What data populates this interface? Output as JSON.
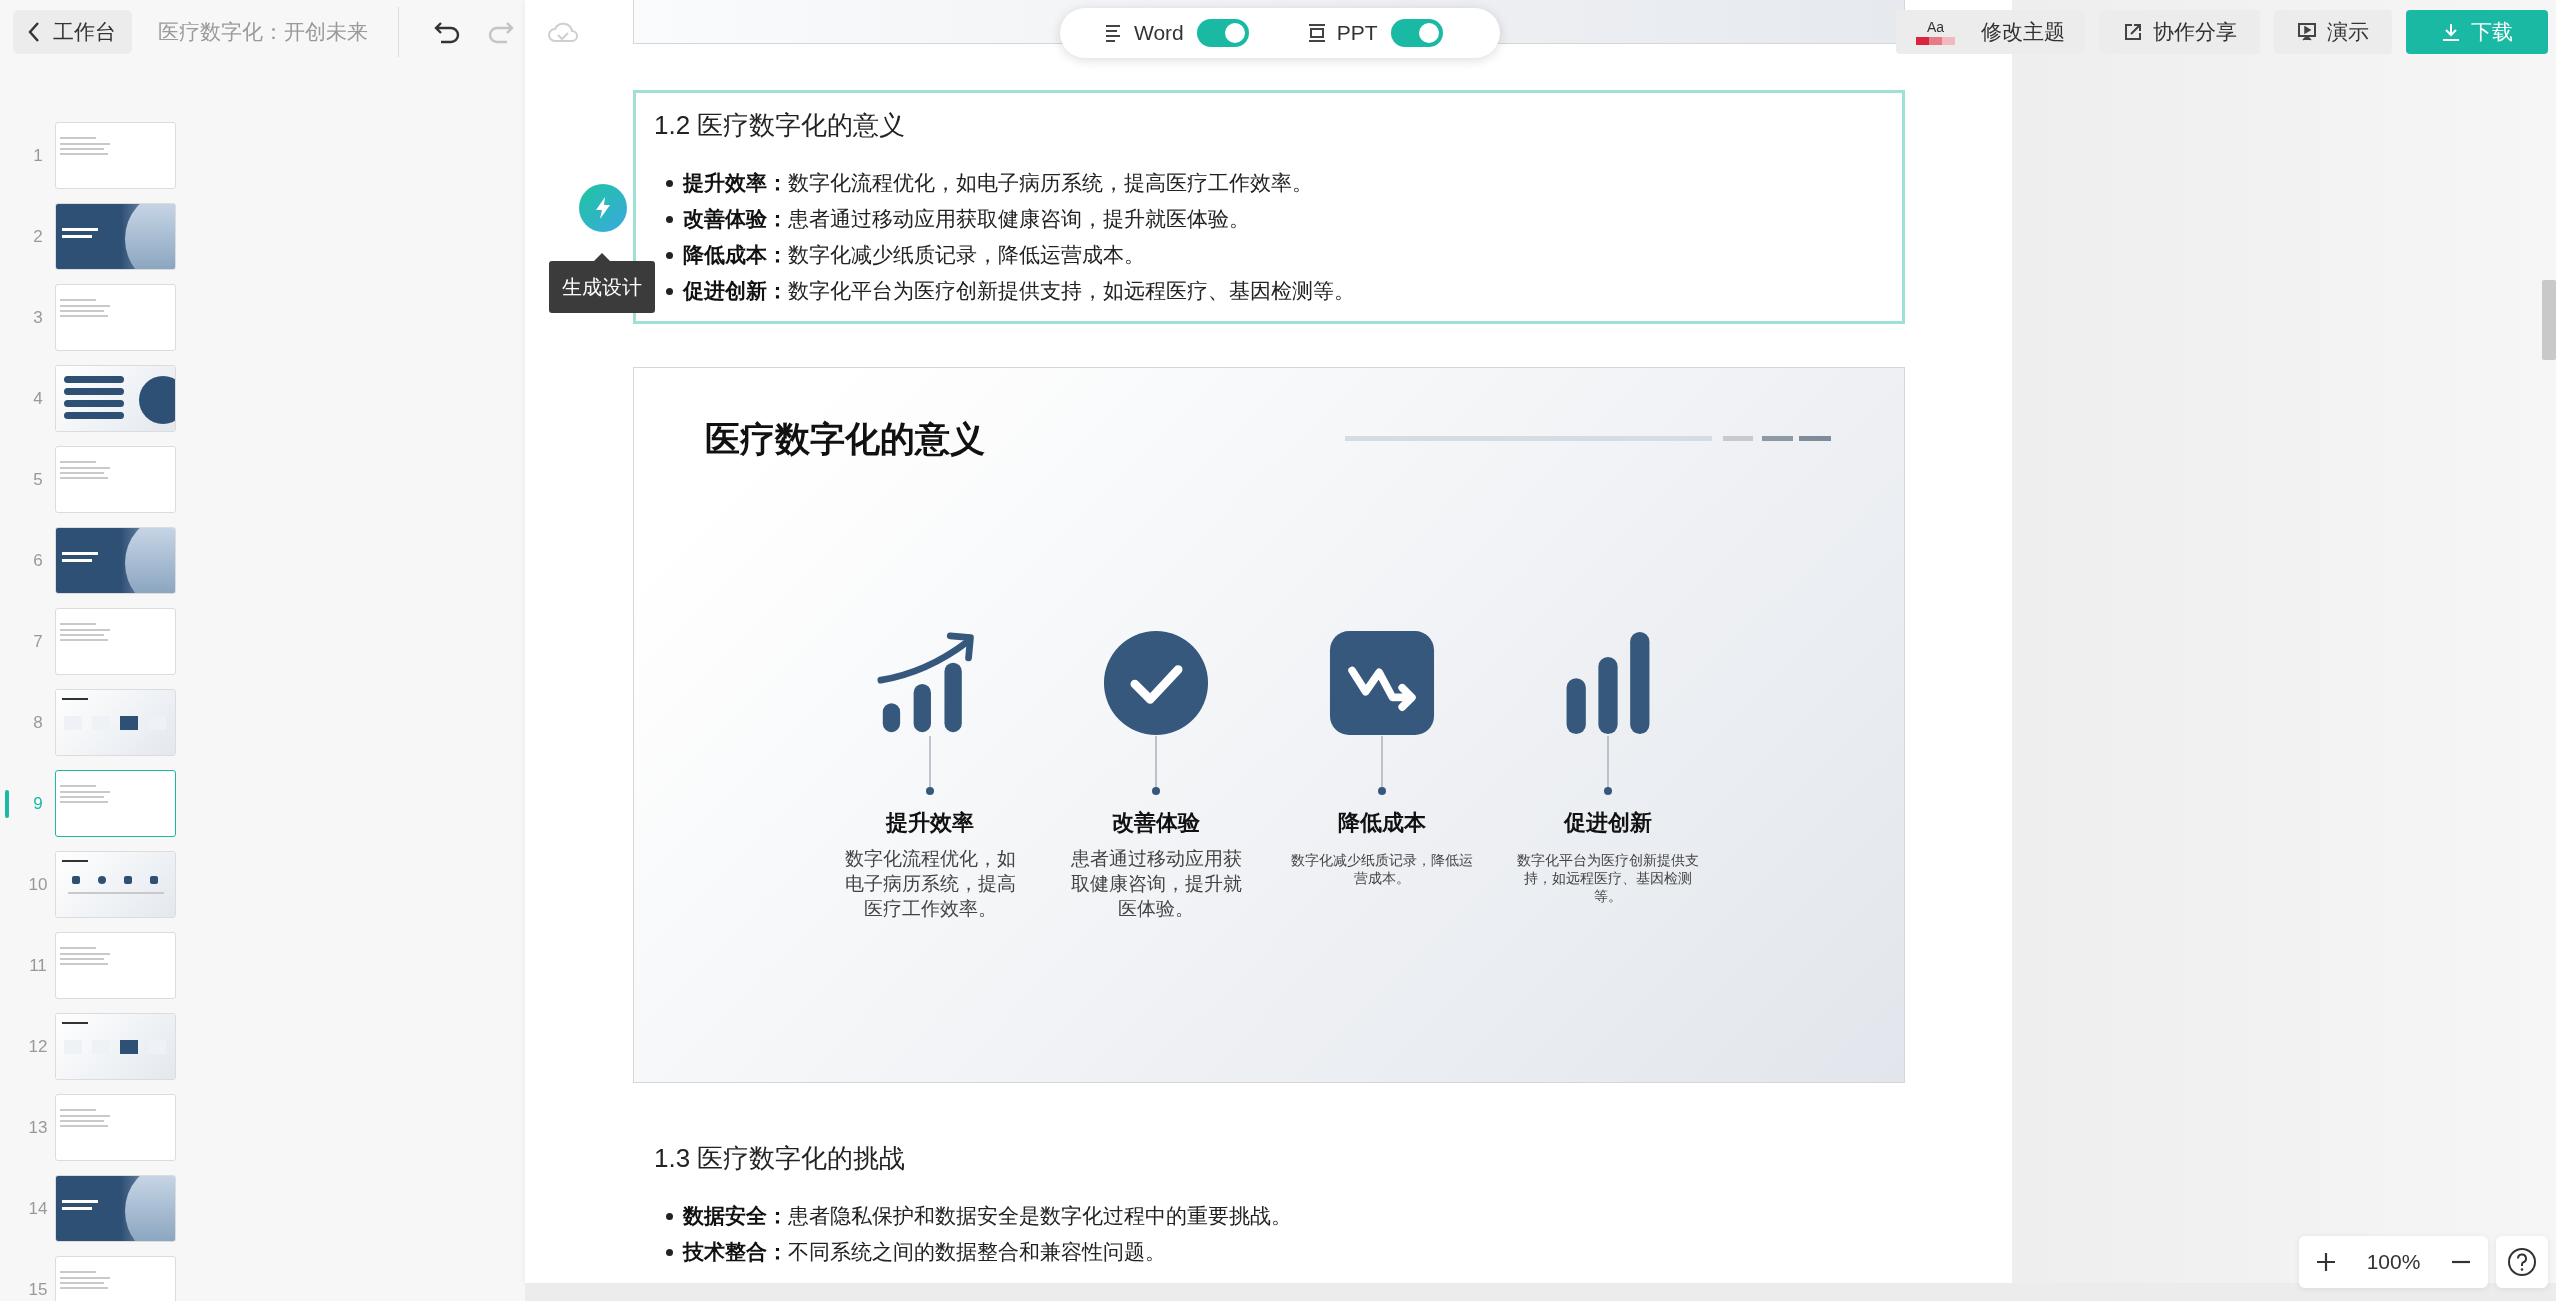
{
  "header": {
    "back_button": "工作台",
    "doc_title": "医疗数字化：开创未来"
  },
  "view_toggles": [
    {
      "kind": "word",
      "label": "Word",
      "on": true
    },
    {
      "kind": "ppt",
      "label": "PPT",
      "on": true
    }
  ],
  "actions": [
    {
      "kind": "theme",
      "sample": "Aa",
      "label": "修改主题"
    },
    {
      "kind": "share",
      "label": "协作分享"
    },
    {
      "kind": "present",
      "label": "演示"
    },
    {
      "kind": "download",
      "label": "下载"
    }
  ],
  "slides": [
    {
      "number": "1",
      "kind": "text",
      "selected": false
    },
    {
      "number": "2",
      "kind": "cover",
      "selected": false
    },
    {
      "number": "3",
      "kind": "text",
      "selected": false
    },
    {
      "number": "4",
      "kind": "toc",
      "selected": false
    },
    {
      "number": "5",
      "kind": "text",
      "selected": false
    },
    {
      "number": "6",
      "kind": "cover",
      "selected": false
    },
    {
      "number": "7",
      "kind": "text",
      "selected": false
    },
    {
      "number": "8",
      "kind": "cards",
      "selected": false
    },
    {
      "number": "9",
      "kind": "text",
      "selected": true
    },
    {
      "number": "10",
      "kind": "icons",
      "selected": false
    },
    {
      "number": "11",
      "kind": "text",
      "selected": false
    },
    {
      "number": "12",
      "kind": "cards",
      "selected": false
    },
    {
      "number": "13",
      "kind": "text",
      "selected": false
    },
    {
      "number": "14",
      "kind": "cover",
      "selected": false
    },
    {
      "number": "15",
      "kind": "text",
      "selected": false
    }
  ],
  "document": [
    {
      "kind": "slide_fragment"
    },
    {
      "kind": "section",
      "focused": true,
      "heading": "1.2 医疗数字化的意义",
      "design_tooltip": "生成设计",
      "bullets": [
        "**提升效率：**数字化流程优化，如电子病历系统，提高医疗工作效率。",
        "**改善体验：**患者通过移动应用获取健康咨询，提升就医体验。",
        "**降低成本：**数字化减少纸质记录，降低运营成本。",
        "**促进创新：**数字化平台为医疗创新提供支持，如远程医疗、基因检测等。"
      ]
    },
    {
      "kind": "slide",
      "title": "医疗数字化的意义",
      "items": [
        {
          "kind": "growth-chart",
          "heading": "提升效率",
          "text": "数字化流程优化，如电子病历系统，提高医疗工作效率。",
          "large_caption": true
        },
        {
          "kind": "check-circle",
          "heading": "改善体验",
          "text": "患者通过移动应用获取健康咨询，提升就医体验。",
          "large_caption": true
        },
        {
          "kind": "trend-square",
          "heading": "降低成本",
          "text": "数字化减少纸质记录，降低运营成本。",
          "large_caption": false
        },
        {
          "kind": "bar-chart",
          "heading": "促进创新",
          "text": "数字化平台为医疗创新提供支持，如远程医疗、基因检测等。",
          "large_caption": false
        }
      ]
    },
    {
      "kind": "section",
      "focused": false,
      "heading": "1.3 医疗数字化的挑战",
      "bullets": [
        "**数据安全：**患者隐私保护和数据安全是数字化过程中的重要挑战。",
        "**技术整合：**不同系统之间的数据整合和兼容性问题。"
      ]
    }
  ],
  "zoom": {
    "value": "100%"
  }
}
